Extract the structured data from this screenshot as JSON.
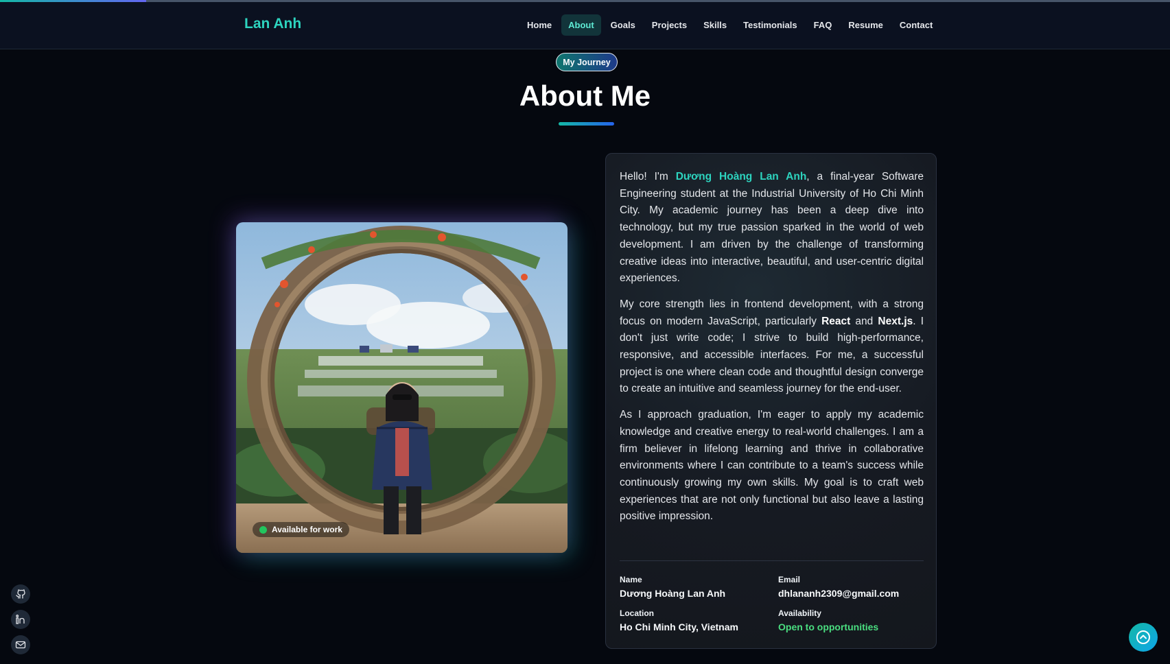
{
  "scroll_progress": 0.125,
  "nav": {
    "logo": "Lan Anh",
    "links": [
      "Home",
      "About",
      "Goals",
      "Projects",
      "Skills",
      "Testimonials",
      "FAQ",
      "Resume",
      "Contact"
    ],
    "active": "About"
  },
  "about": {
    "badge": "My Journey",
    "title": "About Me",
    "photo_badge": "Available for work",
    "p1_intro": "Hello! I'm ",
    "p1_name": "Dương Hoàng Lan Anh",
    "p1_rest": ", a final-year Software Engineering student at the Industrial University of Ho Chi Minh City. My academic journey has been a deep dive into technology, but my true passion sparked in the world of web development. I am driven by the challenge of transforming creative ideas into interactive, beautiful, and user-centric digital experiences.",
    "p2_a": "My core strength lies in frontend development, with a strong focus on modern JavaScript, particularly ",
    "p2_react": "React",
    "p2_and": " and ",
    "p2_next": "Next.js",
    "p2_b": ". I don't just write code; I strive to build high-performance, responsive, and accessible interfaces. For me, a successful project is one where clean code and thoughtful design converge to create an intuitive and seamless journey for the end-user.",
    "p3": "As I approach graduation, I'm eager to apply my academic knowledge and creative energy to real-world challenges. I am a firm believer in lifelong learning and thrive in collaborative environments where I can contribute to a team's success while continuously growing my own skills. My goal is to craft web experiences that are not only functional but also leave a lasting positive impression.",
    "info": {
      "name_label": "Name",
      "name_value": "Dương Hoàng Lan Anh",
      "email_label": "Email",
      "email_value": "dhlananh2309@gmail.com",
      "location_label": "Location",
      "location_value": "Ho Chi Minh City, Vietnam",
      "availability_label": "Availability",
      "availability_value": "Open to opportunities"
    }
  },
  "social": [
    {
      "icon": "github-icon"
    },
    {
      "icon": "linkedin-icon"
    },
    {
      "icon": "mail-icon"
    }
  ],
  "scroll_top_icon": "arrow-up-icon",
  "colors": {
    "accent": "#2dd4bf",
    "background": "#05080f",
    "available": "#22c55e",
    "availability_text": "#4ade80"
  }
}
